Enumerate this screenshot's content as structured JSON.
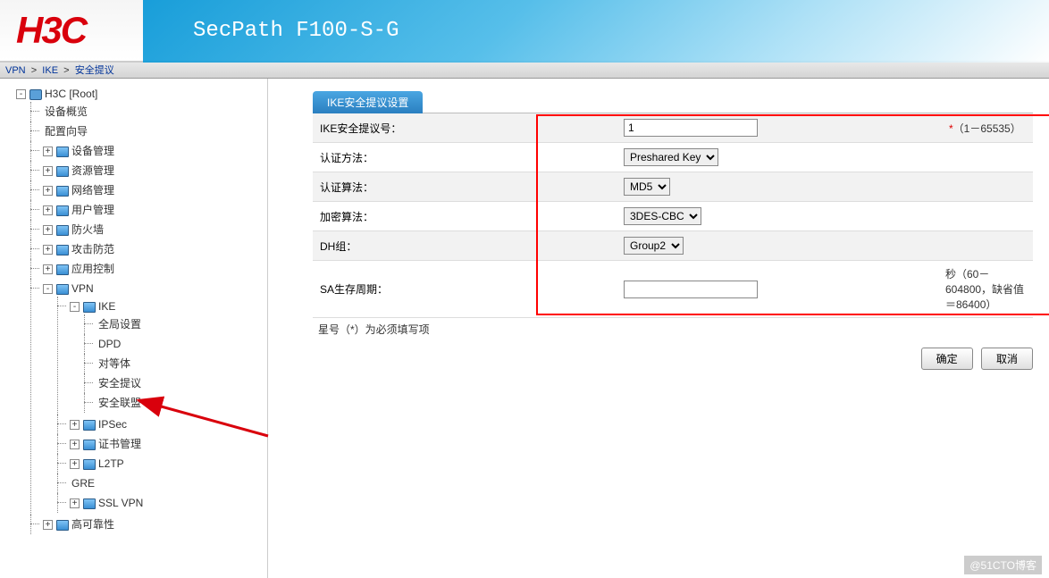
{
  "header": {
    "logo": "H3C",
    "product": "SecPath F100-S-G"
  },
  "breadcrumb": {
    "a": "VPN",
    "b": "IKE",
    "c": "安全提议"
  },
  "tree": {
    "root": "H3C [Root]",
    "n0": "设备概览",
    "n1": "配置向导",
    "n2": "设备管理",
    "n3": "资源管理",
    "n4": "网络管理",
    "n5": "用户管理",
    "n6": "防火墙",
    "n7": "攻击防范",
    "n8": "应用控制",
    "n9": "VPN",
    "ike": "IKE",
    "ike0": "全局设置",
    "ike1": "DPD",
    "ike2": "对等体",
    "ike3": "安全提议",
    "ike4": "安全联盟",
    "ipsec": "IPSec",
    "cert": "证书管理",
    "l2tp": "L2TP",
    "gre": "GRE",
    "sslvpn": "SSL VPN",
    "ha": "高可靠性"
  },
  "tab": "IKE安全提议设置",
  "form": {
    "f0": {
      "label": "IKE安全提议号：",
      "value": "1",
      "hint": "（1－65535）"
    },
    "f1": {
      "label": "认证方法：",
      "value": "Preshared Key"
    },
    "f2": {
      "label": "认证算法：",
      "value": "MD5"
    },
    "f3": {
      "label": "加密算法：",
      "value": "3DES-CBC"
    },
    "f4": {
      "label": "DH组：",
      "value": "Group2"
    },
    "f5": {
      "label": "SA生存周期：",
      "value": "",
      "hint": "秒（60－604800，缺省值＝86400）"
    }
  },
  "note": "星号（*）为必须填写项",
  "btn": {
    "ok": "确定",
    "cancel": "取消"
  },
  "watermark": "@51CTO博客"
}
